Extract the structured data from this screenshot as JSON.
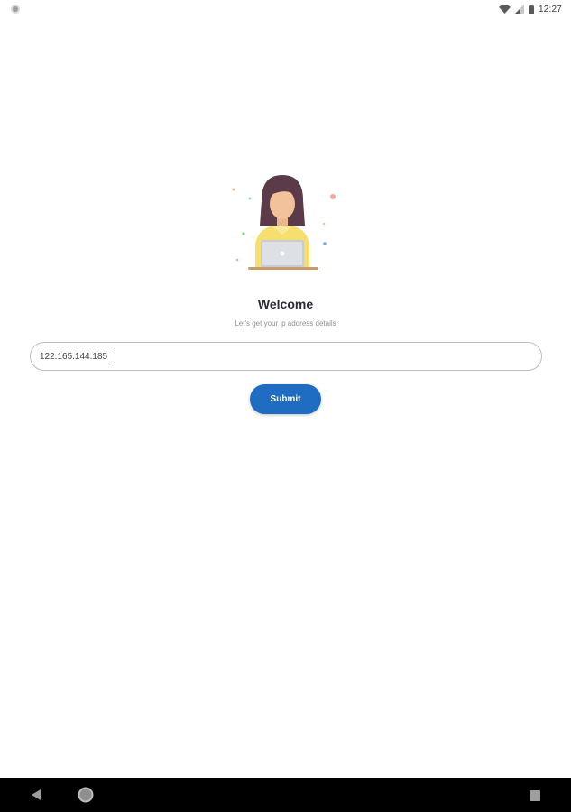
{
  "status_bar": {
    "time": "12:27",
    "icons": [
      "notification-icon",
      "wifi-icon",
      "cellular-signal-icon",
      "battery-icon"
    ]
  },
  "main": {
    "illustration": "woman-with-laptop-illustration",
    "title": "Welcome",
    "subtitle": "Let's get your ip address details",
    "ip_input": {
      "value": "122.165.144.185",
      "placeholder": ""
    },
    "submit_label": "Submit"
  },
  "nav_bar": {
    "icons": [
      "back-icon",
      "home-icon",
      "recents-icon"
    ]
  },
  "colors": {
    "accent": "#1e6dc2",
    "title_text": "#2a2a3a",
    "subtitle_text": "#8f8f8f",
    "input_border": "#bdbdbd",
    "nav_bar_bg": "#000000"
  }
}
